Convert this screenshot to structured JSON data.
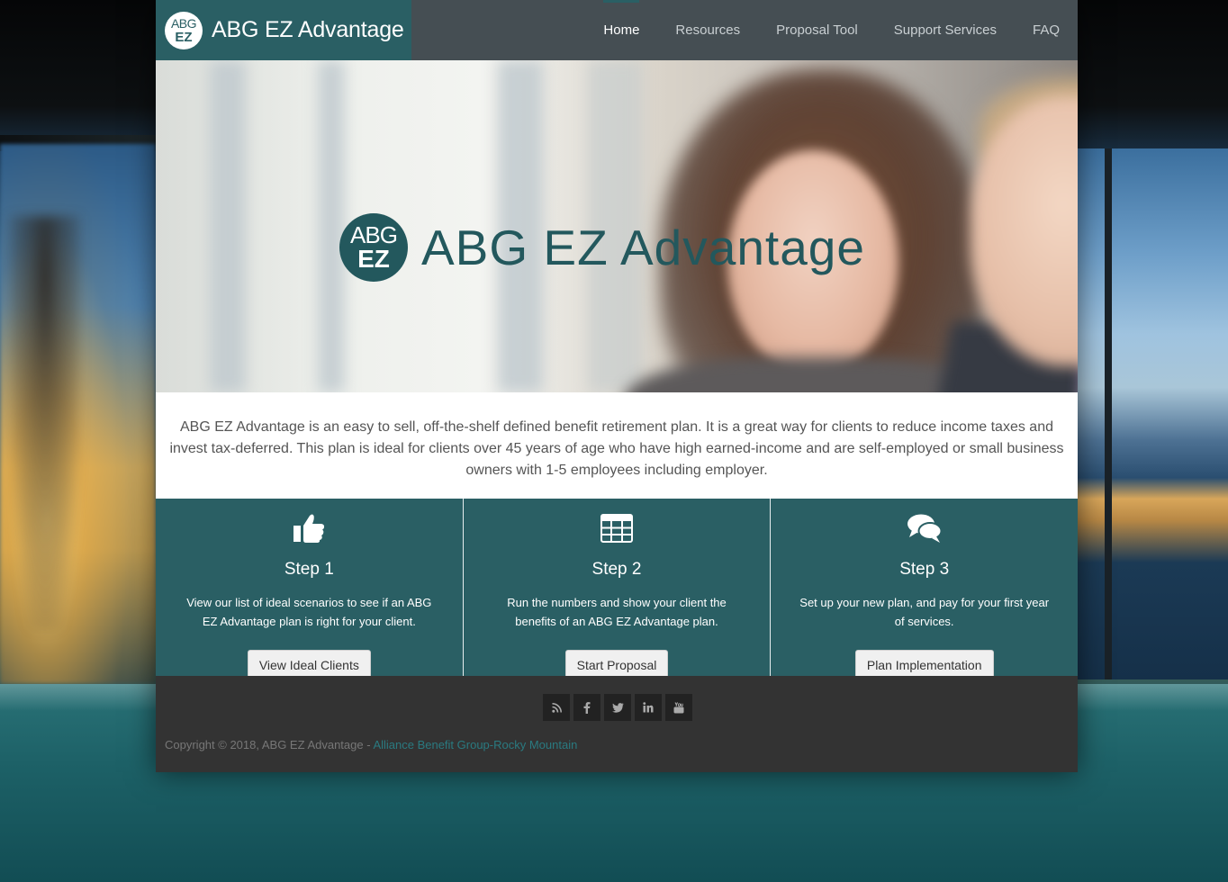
{
  "header": {
    "logo": {
      "line1": "ABG",
      "line2": "EZ"
    },
    "brand_name": "ABG EZ Advantage",
    "nav": [
      {
        "label": "Home",
        "active": true
      },
      {
        "label": "Resources"
      },
      {
        "label": "Proposal Tool"
      },
      {
        "label": "Support Services"
      },
      {
        "label": "FAQ"
      }
    ]
  },
  "hero": {
    "logo": {
      "line1": "ABG",
      "line2": "EZ"
    },
    "title": "ABG EZ Advantage"
  },
  "intro": {
    "text": "ABG EZ Advantage is an easy to sell, off-the-shelf defined benefit retirement plan. It is a great way for clients to reduce income taxes and invest tax-deferred. This plan is ideal for clients over 45 years of age who have high earned-income and are self-employed or small business owners with 1-5 employees including employer."
  },
  "steps": [
    {
      "icon": "thumbs-up-icon",
      "title": "Step 1",
      "description": "View our list of ideal scenarios to see if an ABG EZ Advantage plan is right for your client.",
      "button": "View Ideal Clients"
    },
    {
      "icon": "table-icon",
      "title": "Step 2",
      "description": "Run the numbers and show your client the benefits of an ABG EZ Advantage plan.",
      "button": "Start Proposal"
    },
    {
      "icon": "chat-bubbles-icon",
      "title": "Step 3",
      "description": "Set up your new plan, and pay for your first year of services.",
      "button": "Plan Implementation"
    }
  ],
  "footer": {
    "social": [
      "rss-icon",
      "facebook-icon",
      "twitter-icon",
      "linkedin-icon",
      "youtube-icon"
    ],
    "copyright": "Copyright © 2018, ABG EZ Advantage - ",
    "copyright_link": "Alliance Benefit Group-Rocky Mountain"
  },
  "colors": {
    "brand_teal": "#2a5f64",
    "header_gray": "#454e53",
    "footer_dark": "#333333"
  }
}
